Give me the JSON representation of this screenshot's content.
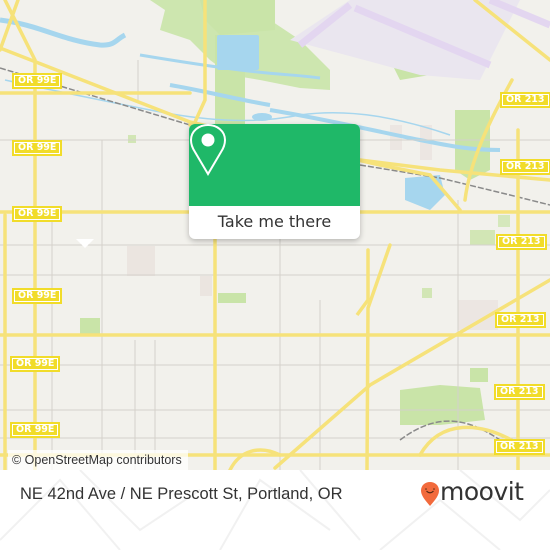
{
  "map": {
    "attribution": "© OpenStreetMap contributors",
    "colors": {
      "background": "#f2f1ec",
      "road_major": "#f6e27a",
      "road_minor": "#cfccc6",
      "water": "#a6d6ee",
      "park": "#c9e4a8",
      "airport": "#e9e3f2",
      "shield": "#f1dc2a"
    },
    "shields": [
      {
        "label": "OR 99E"
      },
      {
        "label": "OR 99E"
      },
      {
        "label": "OR 99E"
      },
      {
        "label": "OR 99E"
      },
      {
        "label": "OR 99E"
      },
      {
        "label": "OR 99E"
      },
      {
        "label": "OR 213"
      },
      {
        "label": "OR 213"
      },
      {
        "label": "OR 213"
      },
      {
        "label": "OR 213"
      },
      {
        "label": "OR 213"
      },
      {
        "label": "OR 213"
      }
    ]
  },
  "popup": {
    "icon": "map-pin-icon",
    "button_label": "Take me there",
    "color": "#1fb868"
  },
  "footer": {
    "address": "NE 42nd Ave / NE Prescott St, Portland, OR",
    "brand": "moovit",
    "brand_icon": "moovit-pin-icon",
    "brand_color": "#f26a3c"
  }
}
